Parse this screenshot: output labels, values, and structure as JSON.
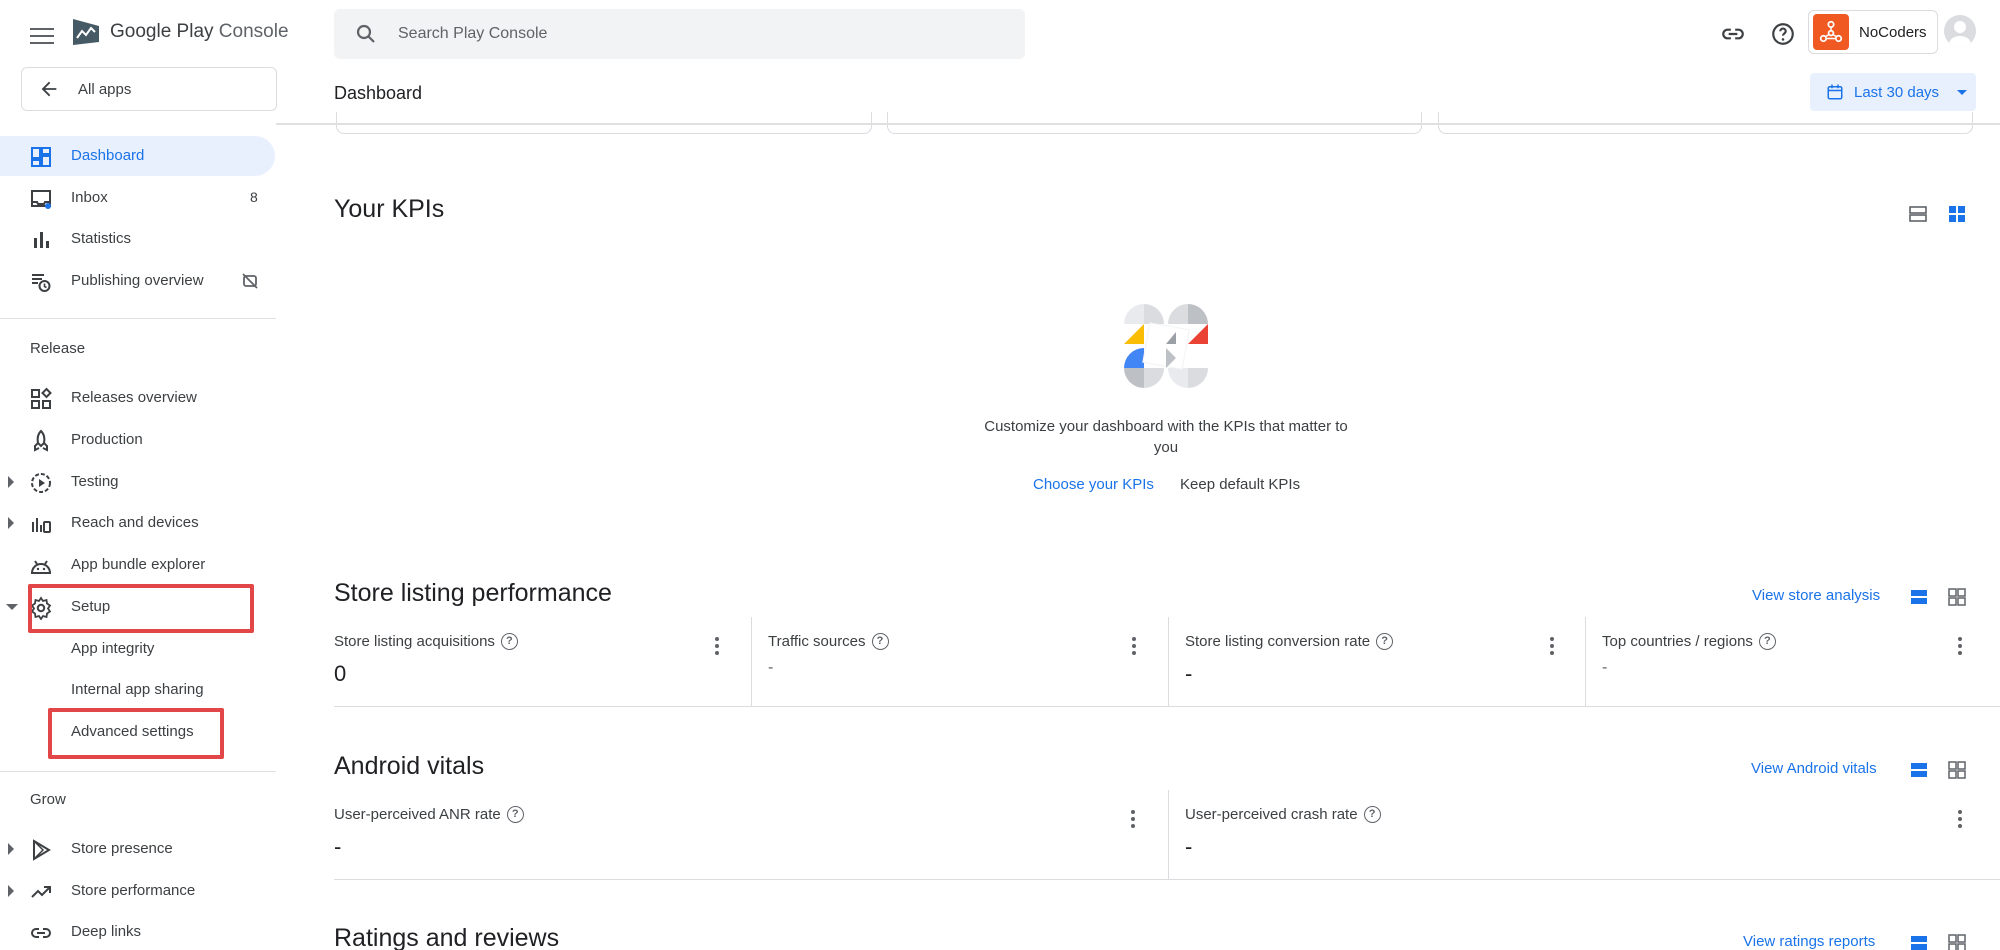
{
  "app": {
    "logo_text_1": "Google Play",
    "logo_text_2": "Console"
  },
  "sidebar": {
    "all_apps": "All apps",
    "items": [
      {
        "label": "Dashboard",
        "icon": "dashboard-icon"
      },
      {
        "label": "Inbox",
        "icon": "inbox-icon",
        "count": "8"
      },
      {
        "label": "Statistics",
        "icon": "bar-chart-icon"
      },
      {
        "label": "Publishing overview",
        "icon": "publishing-overview-icon"
      }
    ],
    "release_label": "Release",
    "release_items": [
      {
        "label": "Releases overview",
        "icon": "releases-overview-icon"
      },
      {
        "label": "Production",
        "icon": "production-icon"
      },
      {
        "label": "Testing",
        "icon": "testing-icon"
      },
      {
        "label": "Reach and devices",
        "icon": "reach-devices-icon"
      },
      {
        "label": "App bundle explorer",
        "icon": "android-icon"
      },
      {
        "label": "Setup",
        "icon": "gear-icon"
      }
    ],
    "setup_subitems": [
      "App integrity",
      "Internal app sharing",
      "Advanced settings"
    ],
    "grow_label": "Grow",
    "grow_items": [
      {
        "label": "Store presence",
        "icon": "play-icon"
      },
      {
        "label": "Store performance",
        "icon": "trending-icon"
      },
      {
        "label": "Deep links",
        "icon": "link-icon"
      }
    ]
  },
  "header": {
    "search_placeholder": "Search Play Console",
    "account_name": "NoCoders",
    "page_title": "Dashboard",
    "date_range": "Last 30 days"
  },
  "kpis": {
    "title": "Your KPIs",
    "description": "Customize your dashboard with the KPIs that matter to you",
    "choose_link": "Choose your KPIs",
    "keep_link": "Keep default KPIs"
  },
  "store_listing": {
    "title": "Store listing performance",
    "link": "View store analysis",
    "metrics": [
      {
        "label": "Store listing acquisitions",
        "value": "0"
      },
      {
        "label": "Traffic sources",
        "value": "-"
      },
      {
        "label": "Store listing conversion rate",
        "value": "-"
      },
      {
        "label": "Top countries / regions",
        "value": "-"
      }
    ]
  },
  "android_vitals": {
    "title": "Android vitals",
    "link": "View Android vitals",
    "metrics": [
      {
        "label": "User-perceived ANR rate",
        "value": "-"
      },
      {
        "label": "User-perceived crash rate",
        "value": "-"
      }
    ]
  },
  "ratings": {
    "title": "Ratings and reviews",
    "link": "View ratings reports"
  },
  "colors": {
    "accent": "#1a73e8",
    "active_bg": "#e8f0fe",
    "highlight": "#e24646",
    "brand_orange": "#f05a22"
  }
}
